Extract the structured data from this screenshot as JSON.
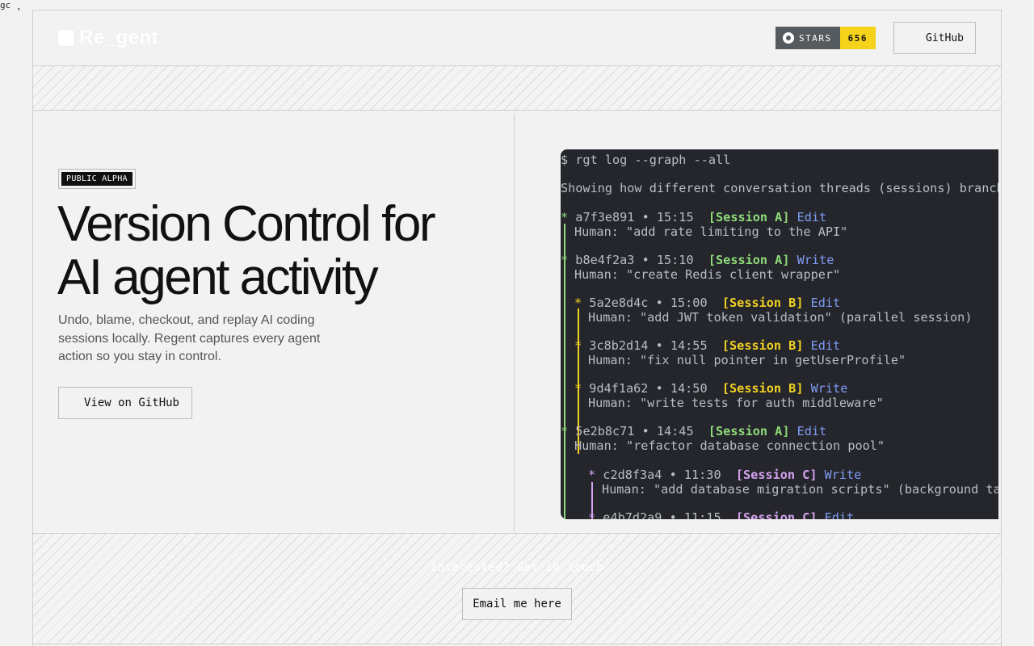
{
  "corner": {
    "text": "gc ̥"
  },
  "header": {
    "logo_text": "Re_gent",
    "stars_label": "STARS",
    "stars_count": "656",
    "github_label": "GitHub"
  },
  "hero": {
    "badge": "PUBLIC ALPHA",
    "title": "Version Control for AI agent activity",
    "subtitle": "Undo, blame, checkout, and replay AI coding sessions locally. Regent captures every agent action so you stay in control.",
    "cta_label": "View on GitHub"
  },
  "terminal": {
    "command": "$ rgt log --graph --all",
    "description": "Showing how different conversation threads (sessions) branch and",
    "entries": [
      {
        "hash": "a7f3e891",
        "time": "15:15",
        "session": "[Session A]",
        "action": "Edit",
        "message": "Human: \"add rate limiting to the API\""
      },
      {
        "hash": "b8e4f2a3",
        "time": "15:10",
        "session": "[Session A]",
        "action": "Write",
        "message": "Human: \"create Redis client wrapper\""
      },
      {
        "hash": "5a2e8d4c",
        "time": "15:00",
        "session": "[Session B]",
        "action": "Edit",
        "message": "Human: \"add JWT token validation\" (parallel session)"
      },
      {
        "hash": "3c8b2d14",
        "time": "14:55",
        "session": "[Session B]",
        "action": "Edit",
        "message": "Human: \"fix null pointer in getUserProfile\""
      },
      {
        "hash": "9d4f1a62",
        "time": "14:50",
        "session": "[Session B]",
        "action": "Write",
        "message": "Human: \"write tests for auth middleware\""
      },
      {
        "hash": "5e2b8c71",
        "time": "14:45",
        "session": "[Session A]",
        "action": "Edit",
        "message": "Human: \"refactor database connection pool\""
      },
      {
        "hash": "c2d8f3a4",
        "time": "11:30",
        "session": "[Session C]",
        "action": "Write",
        "message": "Human: \"add database migration scripts\" (background task)"
      },
      {
        "hash": "e4b7d2a9",
        "time": "11:15",
        "session": "[Session C]",
        "action": "Edit",
        "message": ""
      }
    ],
    "colors": {
      "session_a": "#8fda7a",
      "session_b": "#f2d224",
      "session_c": "#d4a2f0",
      "action": "#7f9cf5"
    }
  },
  "footer": {
    "hatch_text": "Interested? Get in touch",
    "email_label": "Email me here"
  }
}
